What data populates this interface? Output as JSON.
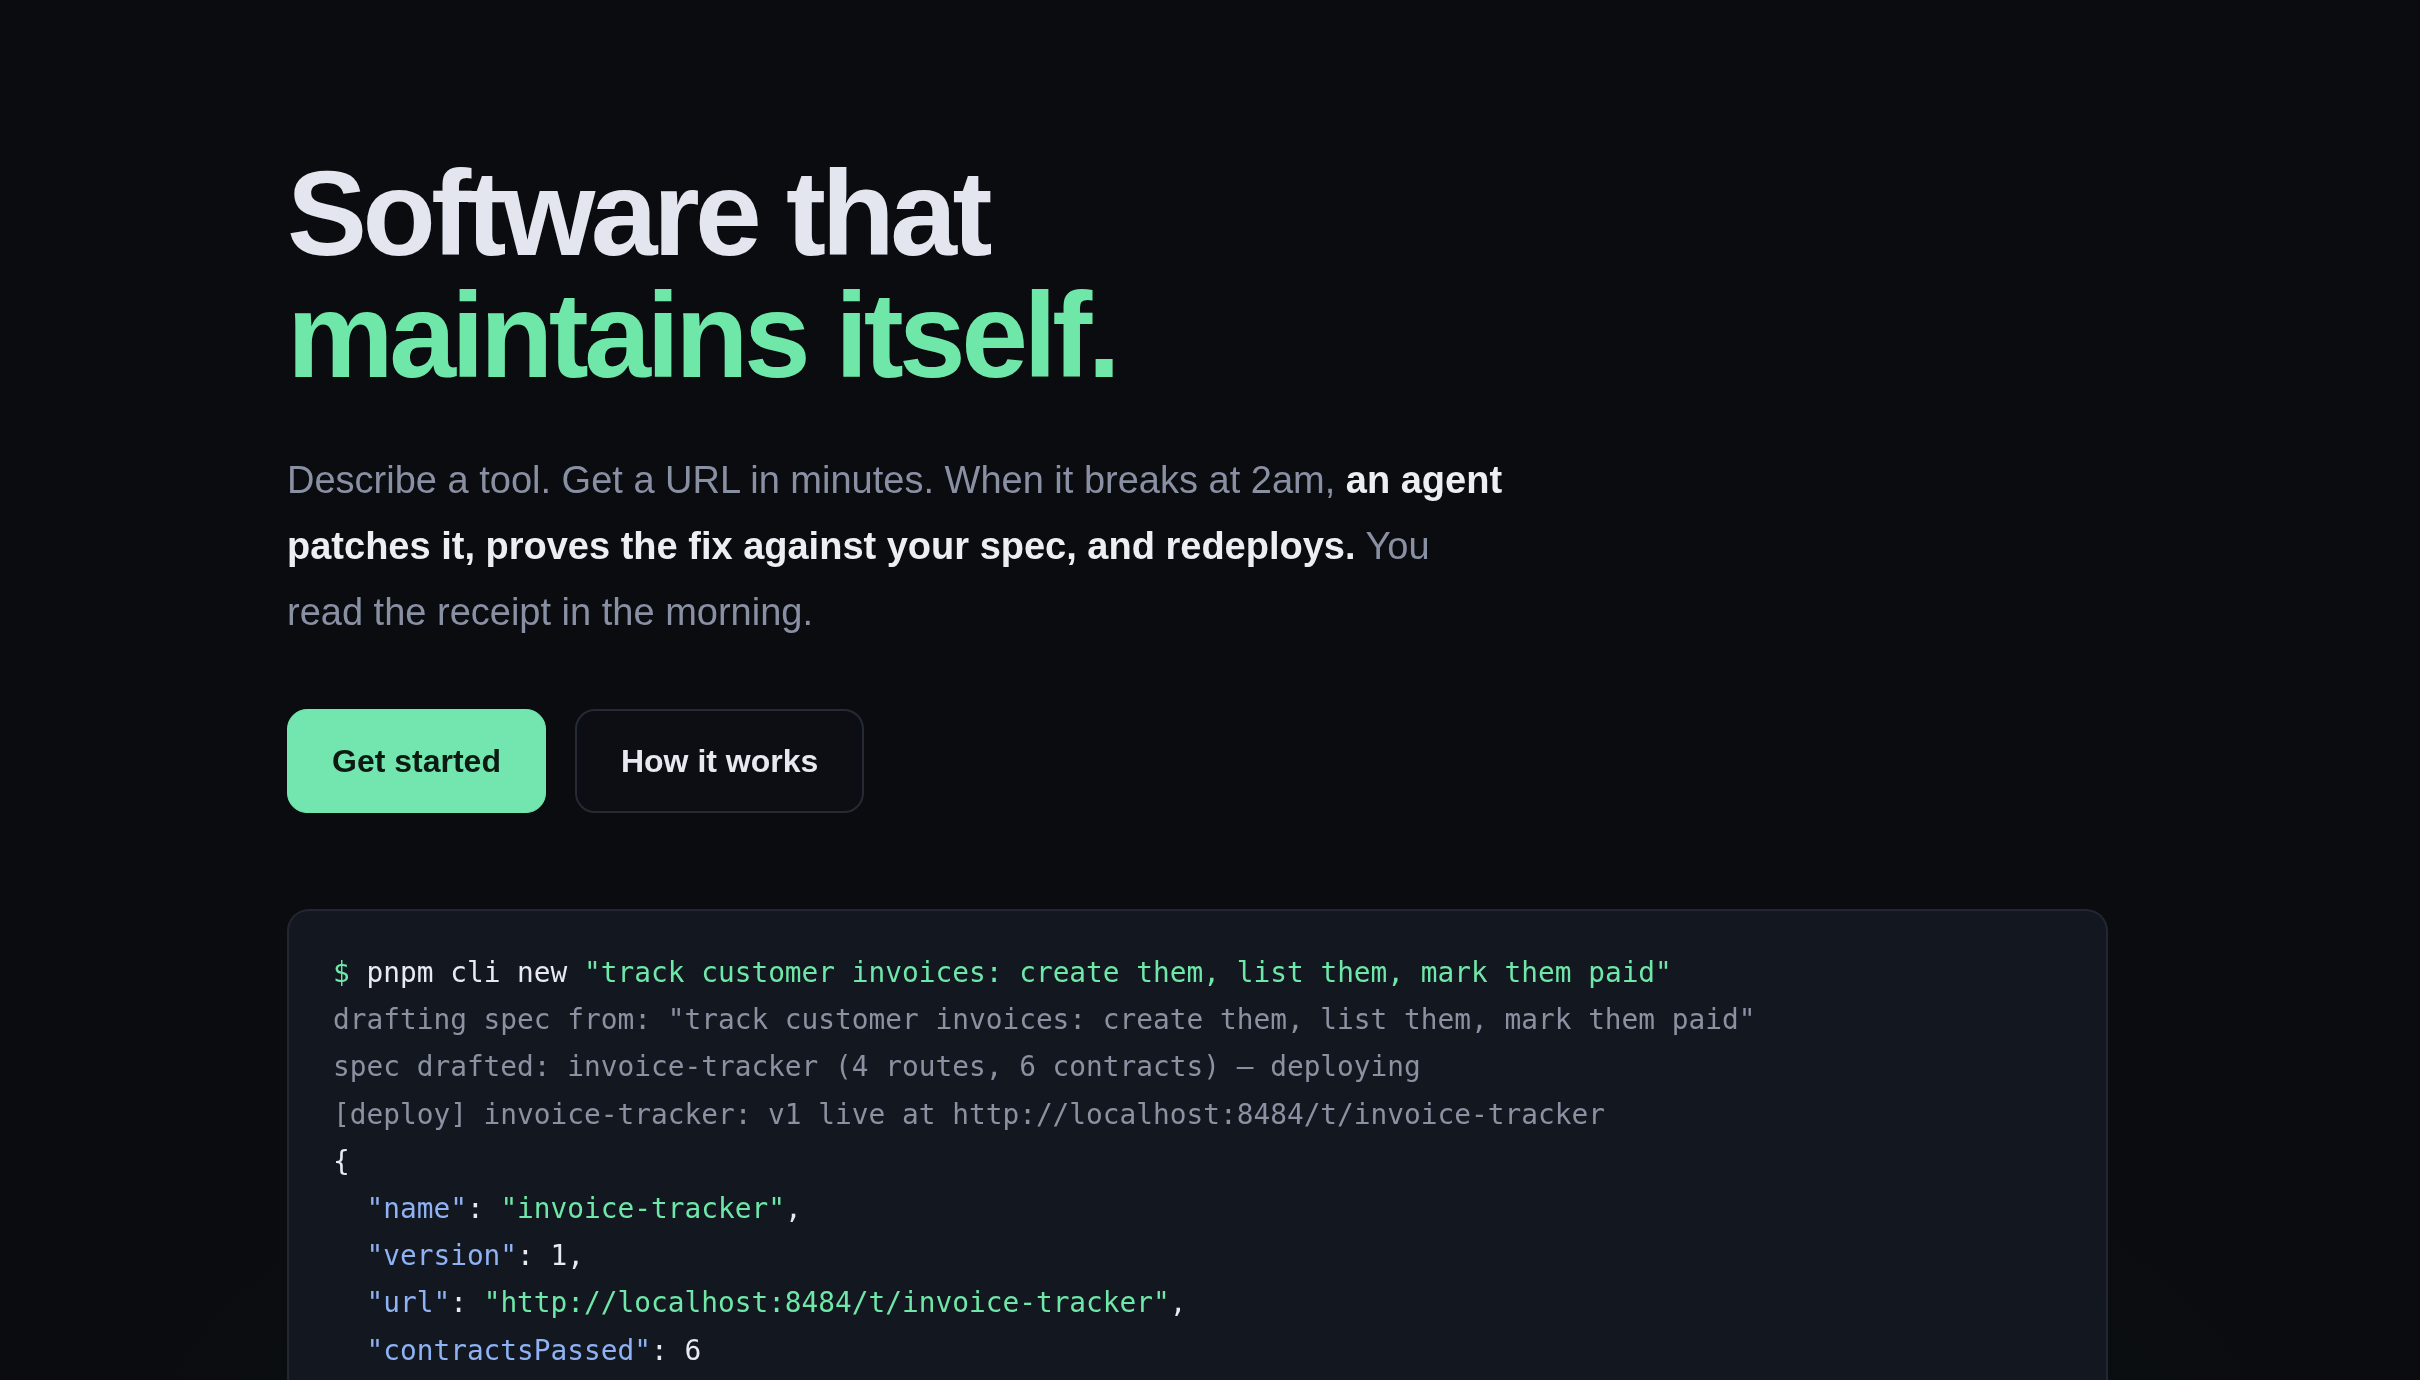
{
  "hero": {
    "headline": "Software that",
    "headline_accent": "maintains itself.",
    "lead": "Describe a tool. Get a URL in minutes. When it breaks at 2am, **an agent patches it, proves the fix against your spec, and redeploys.** You read the receipt in the morning.",
    "buttons": [
      {
        "label": "Get started",
        "kind": "primary"
      },
      {
        "label": "How it works",
        "kind": "outline"
      }
    ]
  },
  "terminal": {
    "lines": [
      {
        "segments": [
          {
            "kind": "prompt",
            "text": "$"
          },
          {
            "kind": "command",
            "text": " pnpm cli new "
          },
          {
            "kind": "string",
            "text": "\"track customer invoices: create them, list them, mark them paid\""
          }
        ]
      },
      {
        "segments": [
          {
            "kind": "output",
            "text": "drafting spec from: \"track customer invoices: create them, list them, mark them paid\""
          }
        ]
      },
      {
        "segments": [
          {
            "kind": "output",
            "text": "spec drafted: invoice-tracker (4 routes, 6 contracts) — deploying"
          }
        ]
      },
      {
        "segments": [
          {
            "kind": "output",
            "text": "[deploy] invoice-tracker: v1 live at http://localhost:8484/t/invoice-tracker"
          }
        ]
      },
      {
        "segments": [
          {
            "kind": "plain",
            "text": "{"
          }
        ],
        "children": [
          {
            "segments": [
              {
                "kind": "key",
                "text": "\"name\""
              },
              {
                "kind": "plain",
                "text": ": "
              },
              {
                "kind": "string",
                "text": "\"invoice-tracker\""
              },
              {
                "kind": "plain",
                "text": ","
              }
            ]
          },
          {
            "segments": [
              {
                "kind": "key",
                "text": "\"version\""
              },
              {
                "kind": "plain",
                "text": ": 1,"
              }
            ]
          },
          {
            "segments": [
              {
                "kind": "key",
                "text": "\"url\""
              },
              {
                "kind": "plain",
                "text": ": "
              },
              {
                "kind": "string",
                "text": "\"http://localhost:8484/t/invoice-tracker\""
              },
              {
                "kind": "plain",
                "text": ","
              }
            ]
          },
          {
            "segments": [
              {
                "kind": "key",
                "text": "\"contractsPassed\""
              },
              {
                "kind": "plain",
                "text": ": 6"
              }
            ]
          }
        ]
      }
    ]
  }
}
